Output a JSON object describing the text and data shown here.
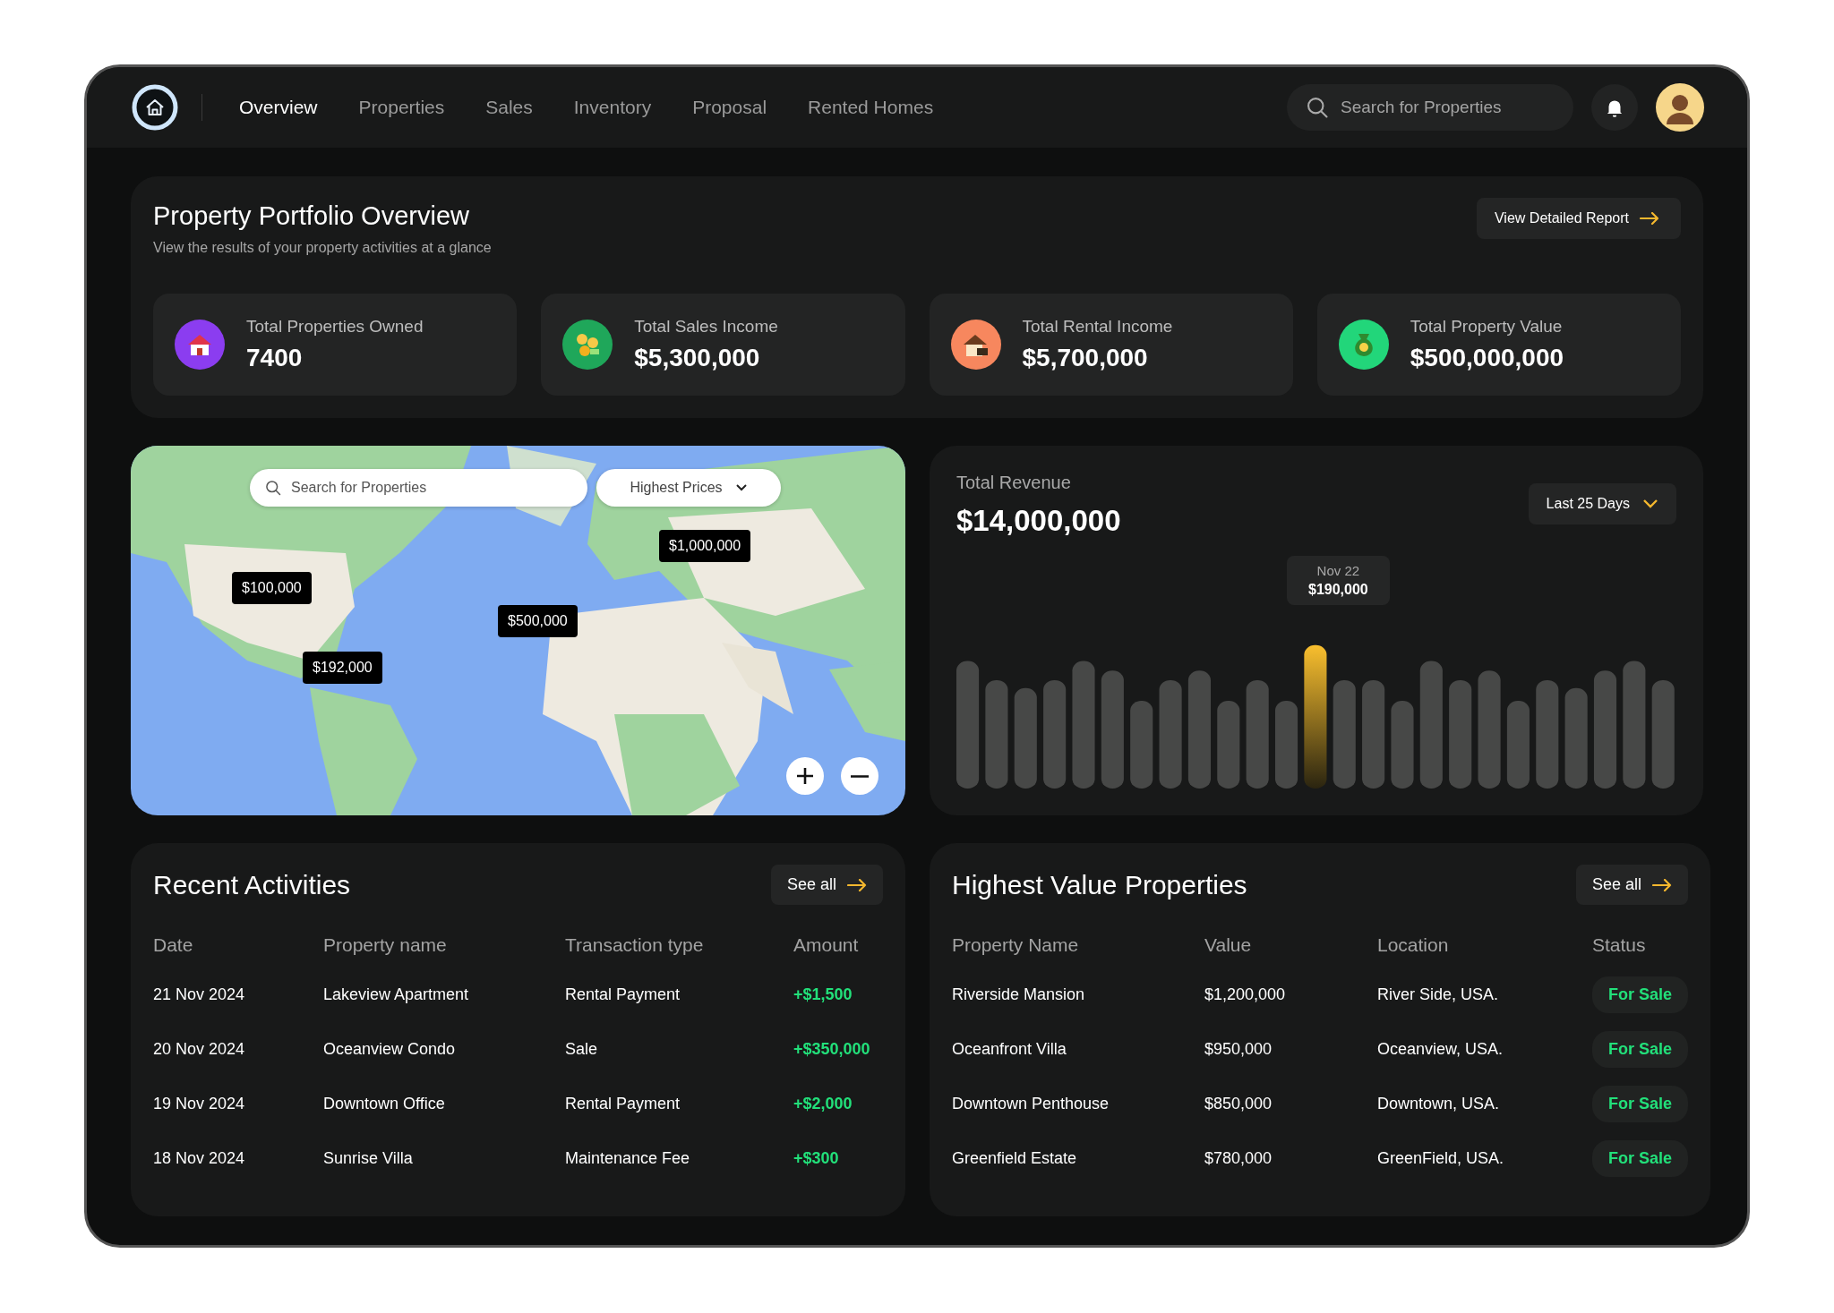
{
  "nav": {
    "items": [
      {
        "label": "Overview",
        "selected": true
      },
      {
        "label": "Properties",
        "selected": false
      },
      {
        "label": "Sales",
        "selected": false
      },
      {
        "label": "Inventory",
        "selected": false
      },
      {
        "label": "Proposal",
        "selected": false
      },
      {
        "label": "Rented Homes",
        "selected": false
      }
    ],
    "search": {
      "placeholder": "Search for Properties"
    }
  },
  "portfolio": {
    "title": "Property Portfolio Overview",
    "subtitle": "View the results of your property activities at a glance",
    "report_button": "View Detailed Report",
    "stats": [
      {
        "label": "Total Properties Owned",
        "value": "7400",
        "color": "#8b3df0",
        "kind": "house"
      },
      {
        "label": "Total Sales Income",
        "value": "$5,300,000",
        "color": "#1fa75a",
        "kind": "coins"
      },
      {
        "label": "Total Rental Income",
        "value": "$5,700,000",
        "color": "#f7875e",
        "kind": "rent"
      },
      {
        "label": "Total Property Value",
        "value": "$500,000,000",
        "color": "#22d67a",
        "kind": "bag"
      }
    ]
  },
  "map": {
    "search": {
      "placeholder": "Search for Properties"
    },
    "filter": "Highest Prices",
    "pins": [
      {
        "label": "$1,000,000"
      },
      {
        "label": "$100,000"
      },
      {
        "label": "$500,000"
      },
      {
        "label": "$192,000"
      }
    ]
  },
  "revenue": {
    "title": "Total Revenue",
    "value": "$14,000,000",
    "range": "Last 25 Days",
    "tooltip": {
      "date": "Nov 22",
      "value": "$190,000"
    }
  },
  "activities": {
    "title": "Recent Activities",
    "see_all": "See all",
    "columns": [
      "Date",
      "Property name",
      "Transaction type",
      "Amount"
    ],
    "rows": [
      [
        "21 Nov 2024",
        "Lakeview Apartment",
        "Rental Payment",
        "+$1,500"
      ],
      [
        "20 Nov 2024",
        "Oceanview Condo",
        "Sale",
        "+$350,000"
      ],
      [
        "19 Nov 2024",
        "Downtown Office",
        "Rental Payment",
        "+$2,000"
      ],
      [
        "18 Nov 2024",
        "Sunrise Villa",
        "Maintenance Fee",
        "+$300"
      ]
    ]
  },
  "properties": {
    "title": "Highest Value Properties",
    "see_all": "See all",
    "columns": [
      "Property Name",
      "Value",
      "Location",
      "Status"
    ],
    "rows": [
      [
        "Riverside Mansion",
        "$1,200,000",
        "River Side, USA.",
        "For Sale"
      ],
      [
        "Oceanfront Villa",
        "$950,000",
        "Oceanview, USA.",
        "For Sale"
      ],
      [
        "Downtown Penthouse",
        "$850,000",
        "Downtown, USA.",
        "For Sale"
      ],
      [
        "Greenfield Estate",
        "$780,000",
        "GreenField, USA.",
        "For Sale"
      ]
    ]
  }
}
